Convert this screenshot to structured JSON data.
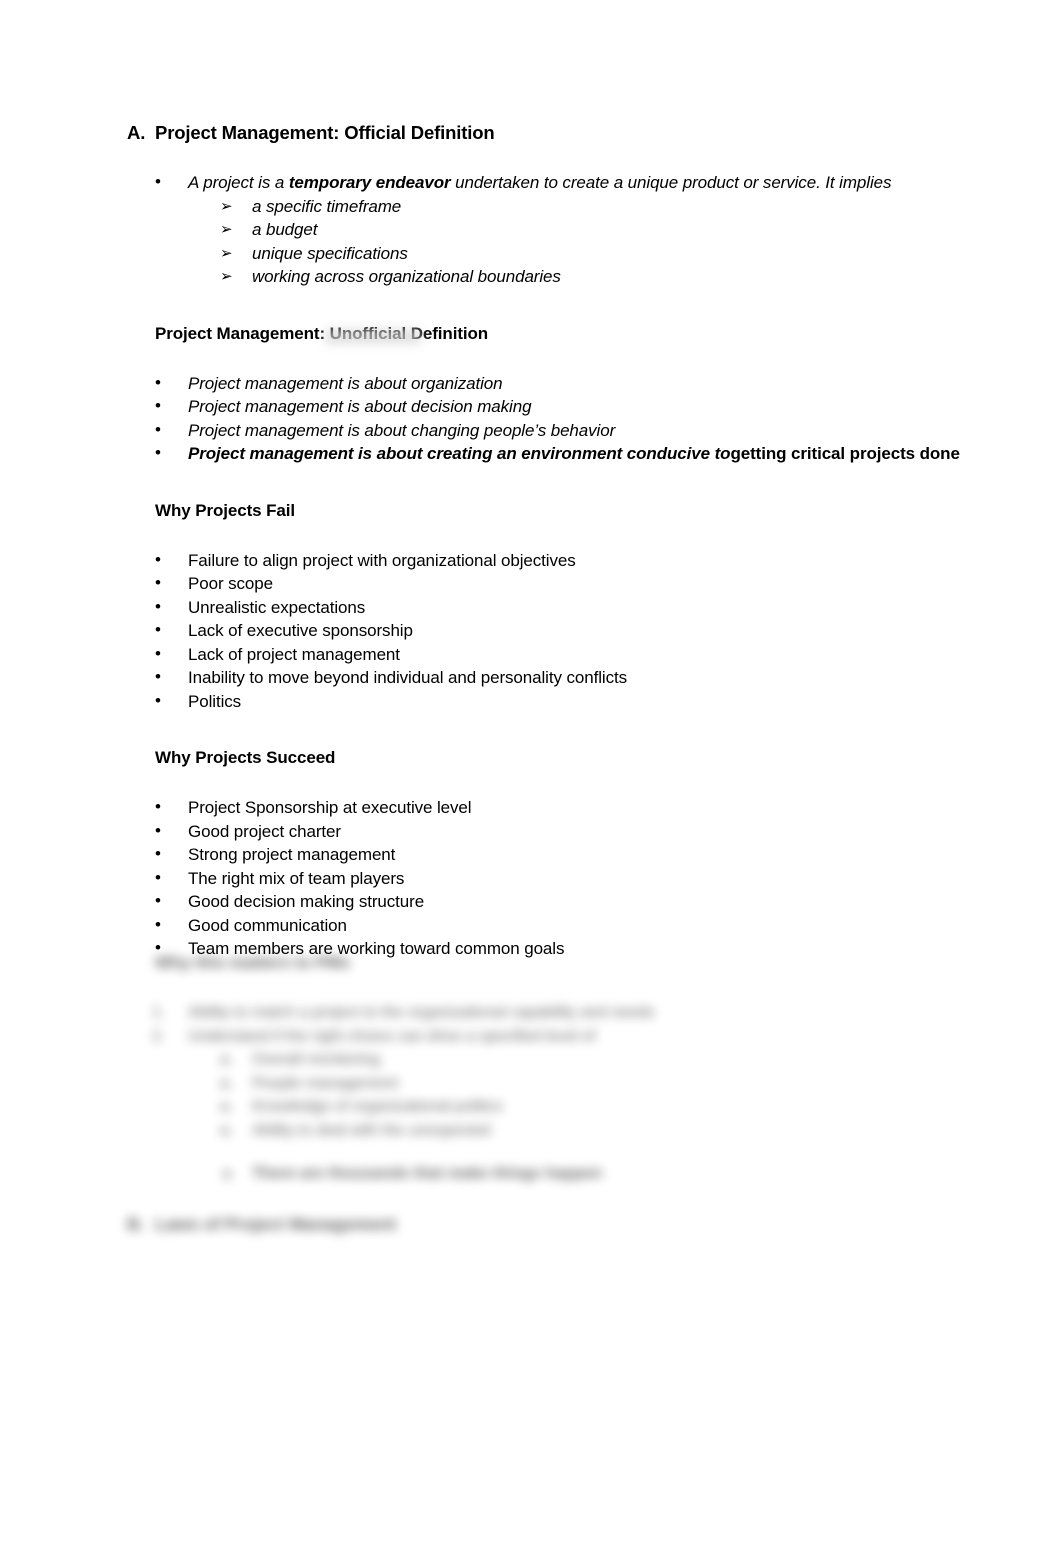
{
  "document": {
    "background_color": "#ffffff",
    "text_color": "#000000"
  },
  "sections": {
    "official": {
      "marker": "A.",
      "title": "Project Management: Official Definition",
      "bullet_marker": "•",
      "lead_bullet": {
        "part1": "A project is a ",
        "emphasis": "temporary endeavor",
        "part2": " undertaken to create a unique product or service. It implies"
      },
      "sub_marker": "➢",
      "sub_items": [
        "a specific timeframe",
        "a budget",
        "unique specifications",
        "working across organizational boundaries"
      ]
    },
    "unofficial": {
      "title": "Project Management: Unofficial Definition",
      "bullet_marker": "•",
      "items": [
        "Project management is about organization",
        "Project management is about decision making",
        "Project management is about changing people’s behavior"
      ],
      "last_item": {
        "italic_part": "Project management is about creating an environment conducive to",
        "upright_part": "getting critical projects done"
      }
    },
    "fail": {
      "title": "Why Projects Fail",
      "bullet_marker": "•",
      "items": [
        "Failure to align project with organizational objectives",
        "Poor scope",
        "Unrealistic expectations",
        "Lack of executive sponsorship",
        "Lack of project management",
        "Inability to move beyond individual and personality conflicts",
        "Politics"
      ]
    },
    "succeed": {
      "title": "Why Projects Succeed",
      "bullet_marker": "•",
      "items": [
        "Project Sponsorship at executive level",
        "Good project charter",
        "Strong project management",
        "The right mix of team players",
        "Good decision making structure",
        "Good communication",
        "Team members are working toward common goals"
      ]
    },
    "redacted": {
      "note": "blurred illegible block",
      "heading": "Why this matters to PMs",
      "numbered_marker_1": "1.",
      "numbered_marker_2": "2.",
      "numbered": [
        "Ability to match a project to the organizational capability and needs",
        "Understand if the right choice can drive a specified level of",
        "Overall monitoring",
        "People management",
        "Knowledge of organizational politics",
        "Ability to deal with the unexpected"
      ],
      "sub_marker": "a.",
      "highlight": "There are thousands that make things happen",
      "heading_b_marker": "B.",
      "heading_b": "Laws of Project Management"
    }
  }
}
